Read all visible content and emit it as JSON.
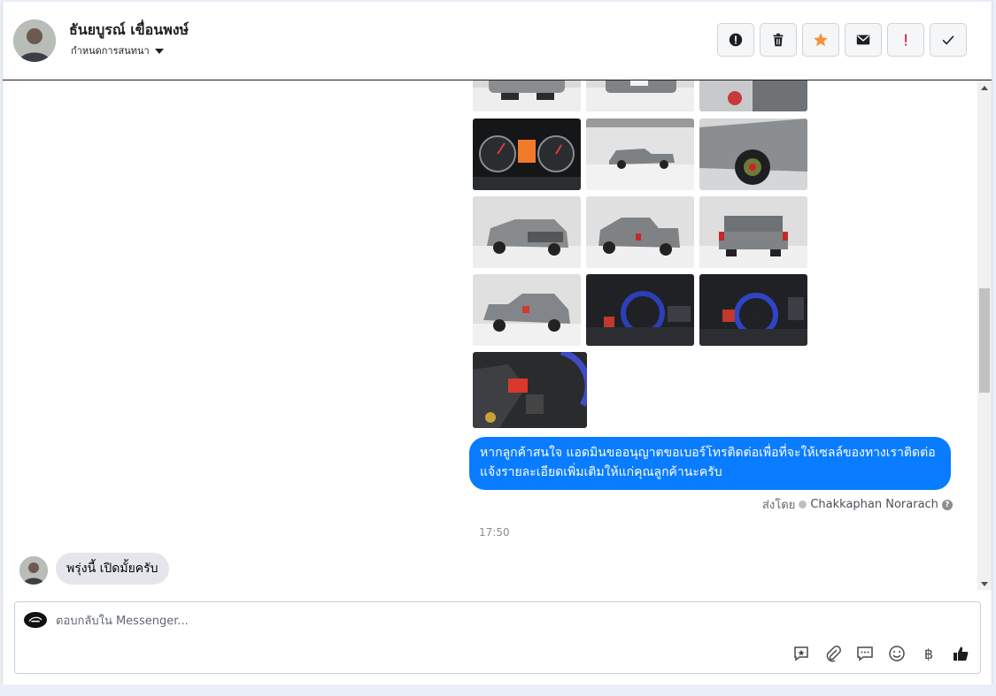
{
  "conversation": {
    "contact_name": "ธันยบูรณ์ เขื่อนพงษ์",
    "label_menu": "กำหนดการสนทนา"
  },
  "header_actions": [
    {
      "icon": "alert-circle-icon"
    },
    {
      "icon": "trash-icon"
    },
    {
      "icon": "star-icon"
    },
    {
      "icon": "envelope-icon"
    },
    {
      "icon": "exclamation-icon"
    },
    {
      "icon": "checkmark-icon"
    }
  ],
  "photos": [
    {
      "subject": "car-front-partial"
    },
    {
      "subject": "car-rear-partial"
    },
    {
      "subject": "door-detail-partial"
    },
    {
      "subject": "instrument-cluster"
    },
    {
      "subject": "car-side-view"
    },
    {
      "subject": "wheel-closeup"
    },
    {
      "subject": "car-front-three-quarter"
    },
    {
      "subject": "car-rear-three-quarter"
    },
    {
      "subject": "car-rear-view"
    },
    {
      "subject": "car-rear-side"
    },
    {
      "subject": "steering-wheel-interior"
    },
    {
      "subject": "steering-wheel-interior-2"
    },
    {
      "subject": "gear-shift-interior"
    }
  ],
  "messages": {
    "outgoing_text": "หากลูกค้าสนใจ แอดมินขออนุญาตขอเบอร์โทรติดต่อเพื่อที่จะให้เซลล์ของทางเราติดต่อแจ้งรายละเอียดเพิ่มเติมให้แก่คุณลูกค้านะครับ",
    "sent_by_prefix": "ส่งโดย",
    "sent_by_agent": "Chakkaphan Norarach",
    "timestamp": "17:50",
    "incoming_text": "พรุ่งนี้ เปิดมั้ยครับ"
  },
  "composer": {
    "placeholder": "ตอบกลับใน Messenger...",
    "value": "",
    "tools": [
      "saved-reply-icon",
      "attachment-icon",
      "chat-bubble-icon",
      "emoji-icon",
      "baht-icon",
      "thumbs-up-icon"
    ],
    "baht_symbol": "฿"
  },
  "colors": {
    "outgoing_bubble": "#0a7cff",
    "incoming_bubble": "#e4e6eb",
    "star": "#f7923a",
    "exclamation": "#e0245e"
  }
}
